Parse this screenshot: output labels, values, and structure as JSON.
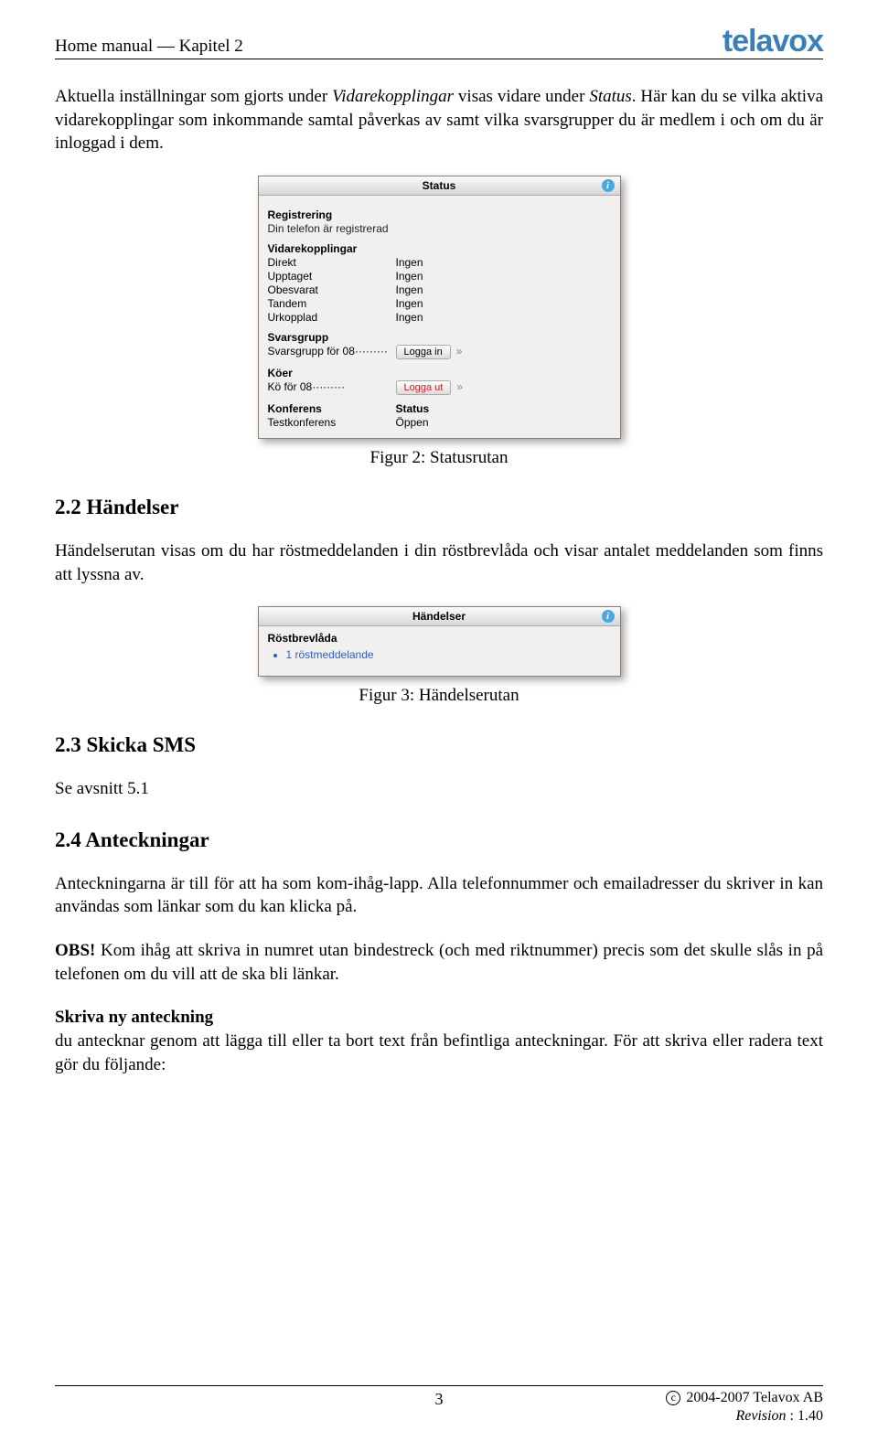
{
  "header": {
    "left": "Home manual — Kapitel 2",
    "logo": "telavox"
  },
  "intro": {
    "t1": "Aktuella inställningar som gjorts under ",
    "em1": "Vidarekopplingar",
    "t2": " visas vidare under ",
    "em2": "Status",
    "t3": ". Här kan du se vilka aktiva vidarekopplingar som inkommande samtal påverkas av samt vilka svarsgrupper du är medlem i och om du är inloggad i dem."
  },
  "fig1": {
    "title": "Status",
    "registrering": {
      "h": "Registrering",
      "line": "Din telefon är registrerad"
    },
    "vidare": {
      "h": "Vidarekopplingar",
      "rows": [
        {
          "k": "Direkt",
          "v": "Ingen"
        },
        {
          "k": "Upptaget",
          "v": "Ingen"
        },
        {
          "k": "Obesvarat",
          "v": "Ingen"
        },
        {
          "k": "Tandem",
          "v": "Ingen"
        },
        {
          "k": "Urkopplad",
          "v": "Ingen"
        }
      ]
    },
    "svarsgrupp": {
      "h": "Svarsgrupp",
      "label": "Svarsgrupp för 08·········",
      "btn": "Logga in"
    },
    "koer": {
      "h": "Köer",
      "label": "Kö för 08·········",
      "btn": "Logga ut"
    },
    "konf": {
      "h": "Konferens",
      "statusH": "Status",
      "name": "Testkonferens",
      "status": "Öppen"
    }
  },
  "cap1": "Figur 2: Statusrutan",
  "h22": "2.2   Händelser",
  "p22": "Händelserutan visas om du har röstmeddelanden i din röstbrevlåda och visar antalet meddelanden som finns att lyssna av.",
  "fig2": {
    "title": "Händelser",
    "sec": "Röstbrevlåda",
    "link": "1 röstmeddelande"
  },
  "cap2": "Figur 3: Händelserutan",
  "h23": "2.3   Skicka SMS",
  "p23a": "Se avsnitt ",
  "p23ref": "5.1",
  "h24": "2.4   Anteckningar",
  "p24a": "Anteckningarna är till för att ha som kom-ihåg-lapp. Alla telefonnummer och emailadresser du skriver in kan användas som länkar som du kan klicka på.",
  "p24b_pre": "OBS!",
  "p24b": " Kom ihåg att skriva in numret utan bindestreck (och med riktnummer) precis som det skulle slås in på telefonen om du vill att de ska bli länkar.",
  "p24c_h": "Skriva ny anteckning",
  "p24c": "du antecknar genom att lägga till eller ta bort text från befintliga anteckningar. För att skriva eller radera text gör du följande:",
  "footer": {
    "page": "3",
    "copy": "2004-2007 Telavox AB",
    "rev_l": "Revision",
    "rev_v": " : 1.40"
  }
}
